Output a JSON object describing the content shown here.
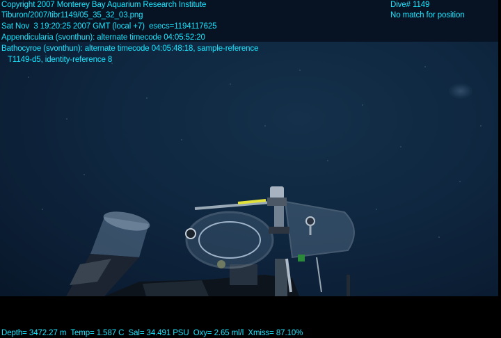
{
  "overlay": {
    "copyright": "Copyright 2007 Monterey Bay Aquarium Research Institute",
    "filename": "Tiburon/2007/tibr1149/05_35_32_03.png",
    "datetime": "Sat Nov  3 19:20:25 2007 GMT (local +7)  esecs=1194117625",
    "annotation_1": "Appendicularia (svonthun): alternate timecode 04:05:52:20",
    "annotation_2": "Bathocyroe (svonthun): alternate timecode 04:05:48:18, sample-reference",
    "annotation_3": "T1149-d5, identity-reference 8",
    "dive": "Dive# 1149",
    "position": "No match for position",
    "sensors": "Depth= 3472.27 m  Temp= 1.587 C  Sal= 34.491 PSU  Oxy= 2.65 ml/l  Xmiss= 87.10%"
  },
  "colors": {
    "overlay_text": "#19e6ff",
    "water": "#0f2740",
    "background": "#000000"
  }
}
